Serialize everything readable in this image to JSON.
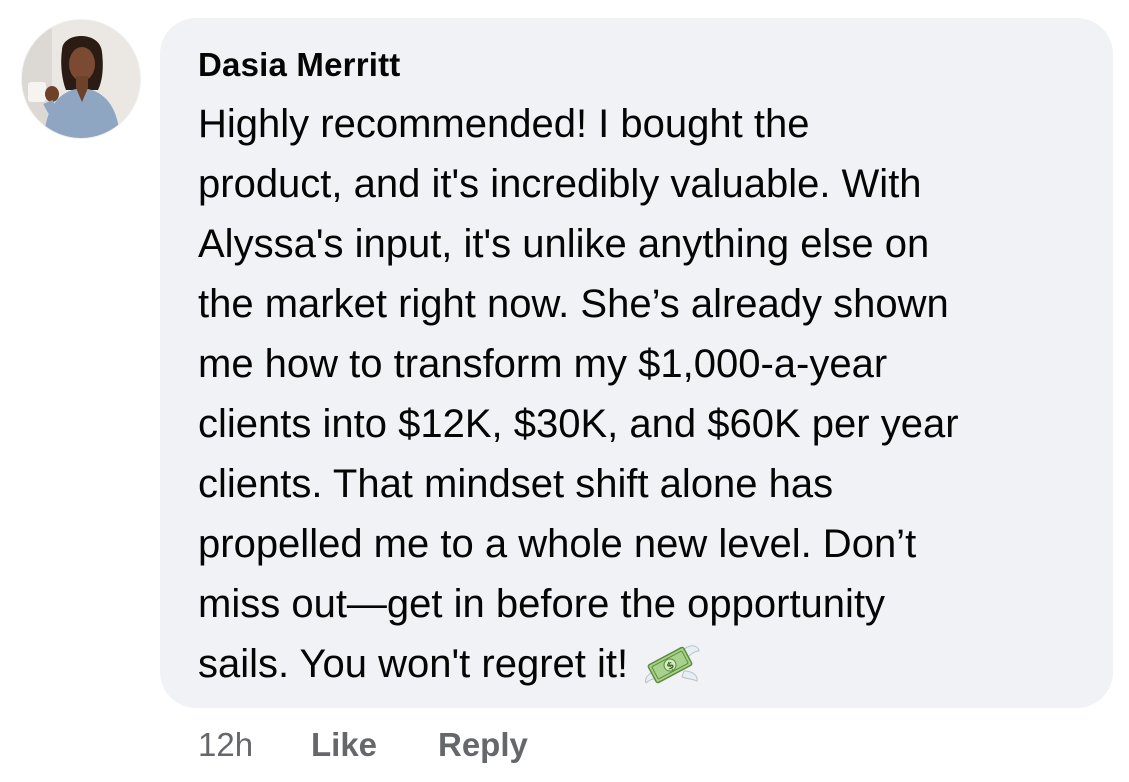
{
  "comment": {
    "author": "Dasia Merritt",
    "avatar_icon": "profile-photo",
    "body_lines": [
      "Highly recommended! I bought the",
      "product, and it's incredibly valuable. With",
      "Alyssa's input, it's unlike anything else on",
      "the market right now. She’s already shown",
      "me how to transform my $1,000-a-year",
      "clients into $12K, $30K, and $60K per year",
      "clients. That mindset shift alone has",
      "propelled me to a whole new level. Don’t",
      "miss out—get in before the opportunity",
      "sails. You won't regret it!"
    ],
    "emoji_icon": "money-with-wings-emoji",
    "bubble_color": "#f0f2f5"
  },
  "actions": {
    "timestamp": "12h",
    "like_label": "Like",
    "reply_label": "Reply",
    "action_color": "#65676b"
  }
}
